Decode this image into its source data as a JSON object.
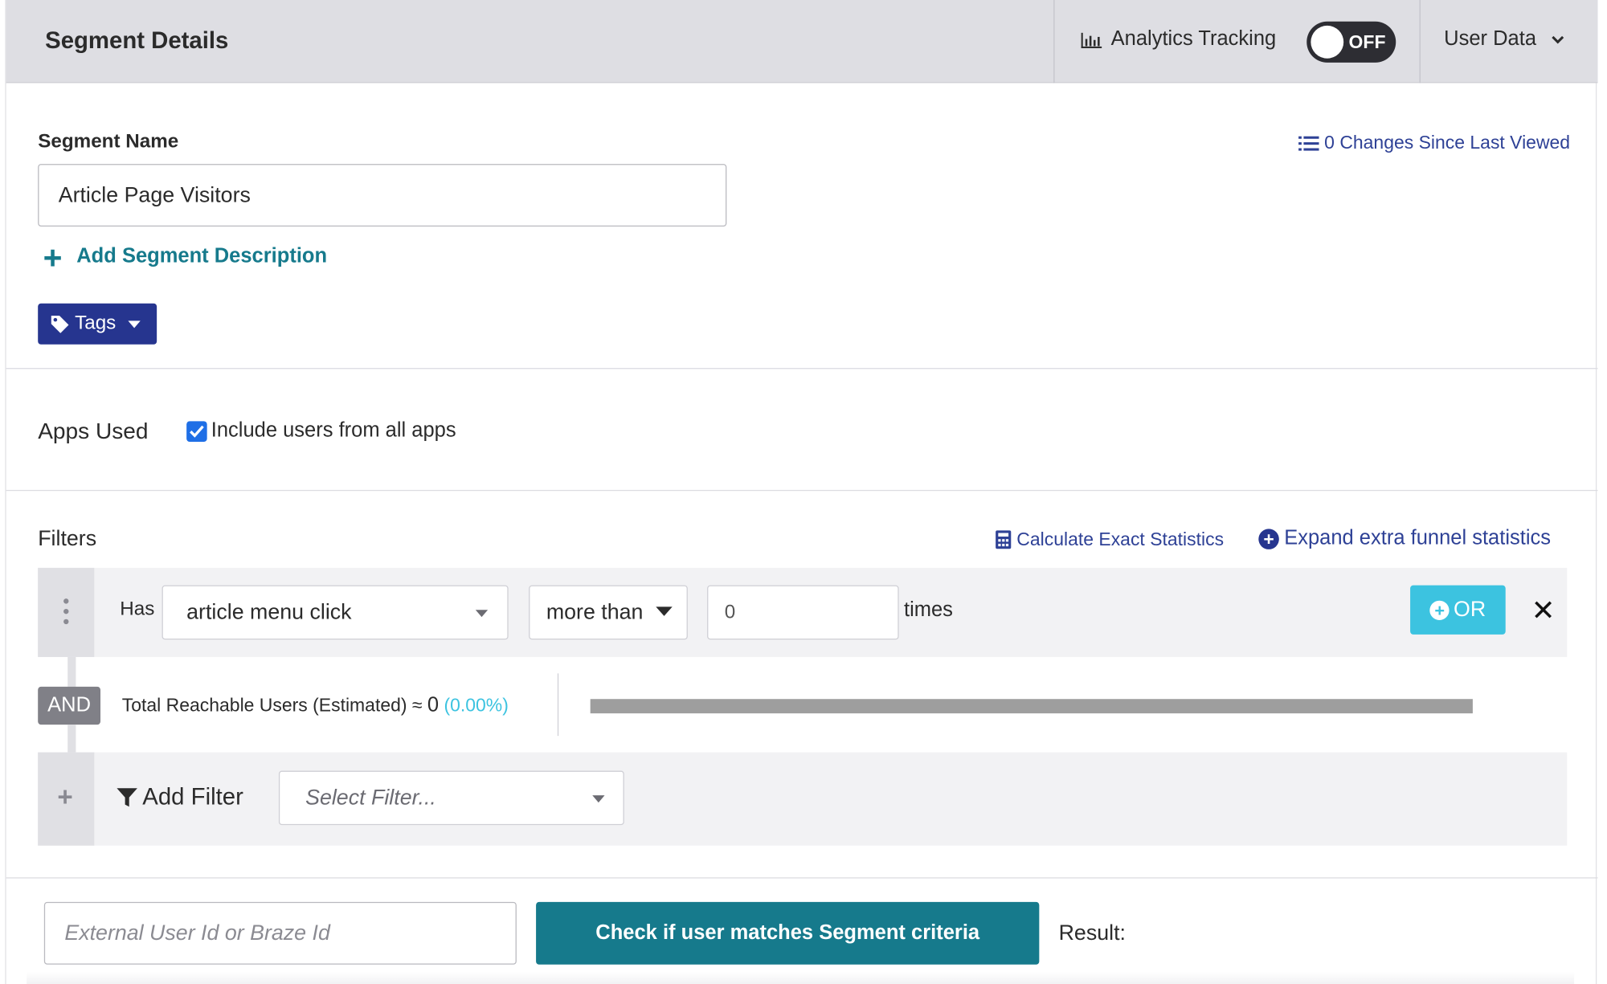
{
  "header": {
    "title": "Segment Details",
    "analytics_label": "Analytics Tracking",
    "toggle_state": "OFF",
    "user_data_label": "User Data"
  },
  "segment": {
    "name_label": "Segment Name",
    "name_value": "Article Page Visitors",
    "changes_link": "0 Changes Since Last Viewed",
    "add_description": "Add Segment Description",
    "tags_label": "Tags"
  },
  "apps": {
    "label": "Apps Used",
    "include_all_label": "Include users from all apps",
    "include_all_checked": true
  },
  "filters": {
    "label": "Filters",
    "calc_link": "Calculate Exact Statistics",
    "expand_link": "Expand extra funnel statistics",
    "rows": [
      {
        "prefix": "Has",
        "event": "article menu click",
        "comparator": "more than",
        "value": "0",
        "suffix": "times",
        "or_label": "OR",
        "remove_glyph": "✕"
      }
    ],
    "and_label": "AND",
    "reach_text": "Total Reachable Users (Estimated) ≈ ",
    "reach_count": "0",
    "reach_pct": "(0.00%)",
    "reach_fraction": 0.0,
    "add_filter_label": "Add Filter",
    "select_placeholder": "Select Filter..."
  },
  "bottom": {
    "id_placeholder": "External User Id or Braze Id",
    "check_button": "Check if user matches Segment criteria",
    "result_label": "Result:"
  },
  "colors": {
    "header_bg": "#dedee3",
    "primary_navy": "#26358f",
    "link_blue": "#2e4196",
    "teal": "#167a8c",
    "cyan": "#3cc3e0"
  }
}
